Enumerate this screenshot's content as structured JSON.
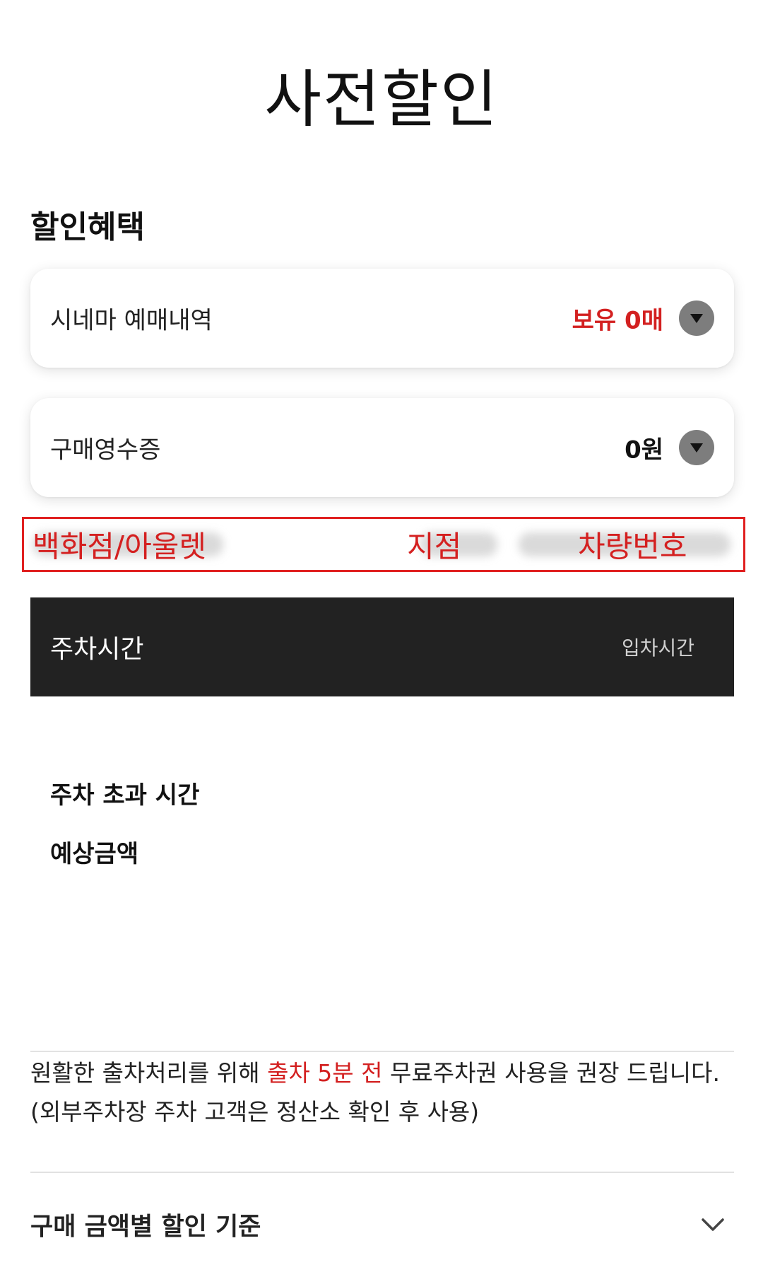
{
  "header": {
    "title": "사전할인"
  },
  "discount": {
    "section_title": "할인혜택",
    "cinema": {
      "label": "시네마 예매내역",
      "value": "보유 0매"
    },
    "receipt": {
      "label": "구매영수증",
      "value": "0원"
    }
  },
  "store": {
    "type": "백화점/아울렛",
    "branch": "지점",
    "plate": "차량번호"
  },
  "parking": {
    "label": "주차시간",
    "entry_label": "입차시간"
  },
  "summary": {
    "over_time_label": "주차 초과 시간",
    "estimated_amount_label": "예상금액"
  },
  "notice": {
    "text_before": "원활한 출차처리를 위해 ",
    "highlight": "출차 5분 전",
    "text_after": " 무료주차권 사용을 권장 드립니다.",
    "sub_note": "(외부주차장 주차 고객은 정산소 확인 후 사용)"
  },
  "criteria": {
    "label": "구매 금액별 할인 기준"
  },
  "colors": {
    "accent_red": "#d32020",
    "dark_bar": "#222222",
    "dropdown_gray": "#7d7d7d"
  },
  "icons": {
    "dropdown": "triangle-down-icon",
    "expand": "chevron-down-icon"
  }
}
